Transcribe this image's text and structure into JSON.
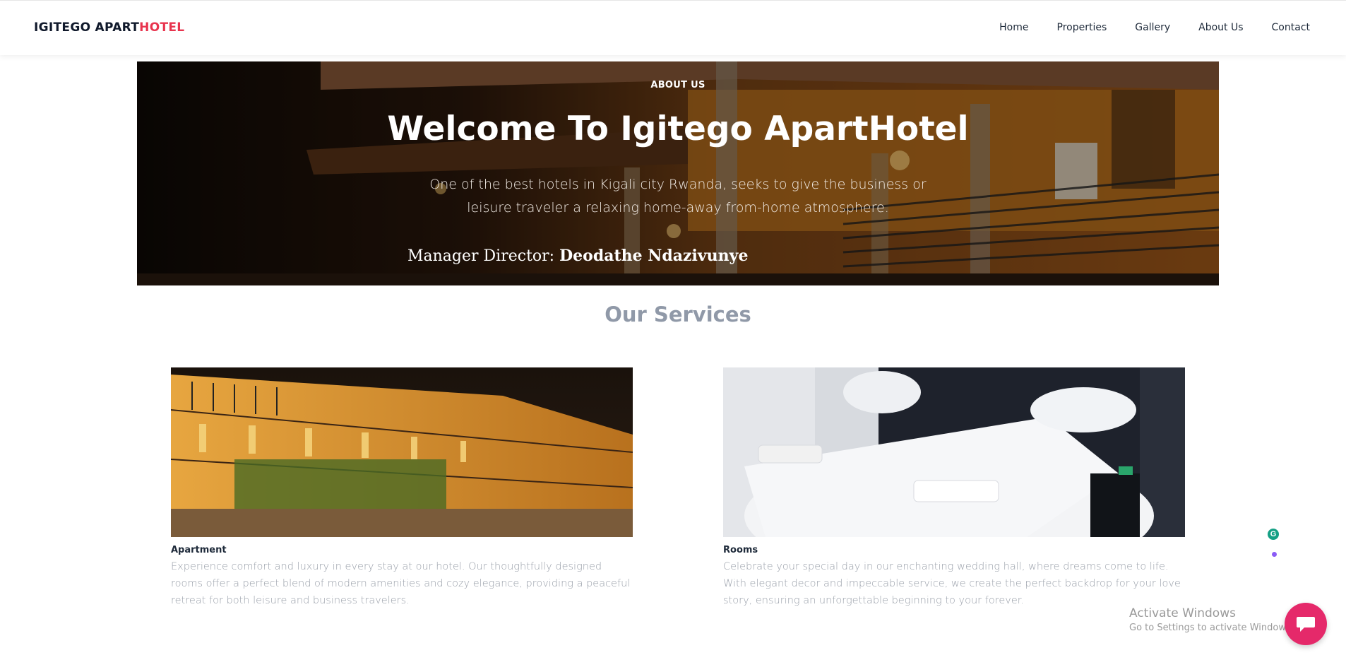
{
  "brand": {
    "part1": "IGITEGO APART",
    "part2": "HOTEL",
    "accent_color": "#e8344e"
  },
  "nav": {
    "items": [
      "Home",
      "Properties",
      "Gallery",
      "About Us",
      "Contact"
    ]
  },
  "hero": {
    "kicker": "ABOUT US",
    "title": "Welcome To Igitego ApartHotel",
    "text": "One of the best hotels in Kigali city Rwanda, seeks to give the business or leisure traveler a relaxing home-away from-home atmosphere.",
    "manager_label": "Manager Director:",
    "manager_name": "Deodathe Ndazivunye"
  },
  "services": {
    "title": "Our Services",
    "cards": [
      {
        "name": "Apartment",
        "description": "Experience comfort and luxury in every stay at our hotel. Our thoughtfully designed rooms offer a perfect blend of modern amenities and cozy elegance, providing a peaceful retreat for both leisure and business travelers."
      },
      {
        "name": "Rooms",
        "description": "Celebrate your special day in our enchanting wedding hall, where dreams come to life. With elegant decor and impeccable service, we create the perfect backdrop for your love story, ensuring an unforgettable beginning to your forever."
      }
    ]
  },
  "widgets": {
    "grammarly_icon": "grammarly-icon",
    "chat_icon": "chat-bubble-icon",
    "windows_line1": "Activate Windows",
    "windows_line2": "Go to Settings to activate Windows."
  }
}
